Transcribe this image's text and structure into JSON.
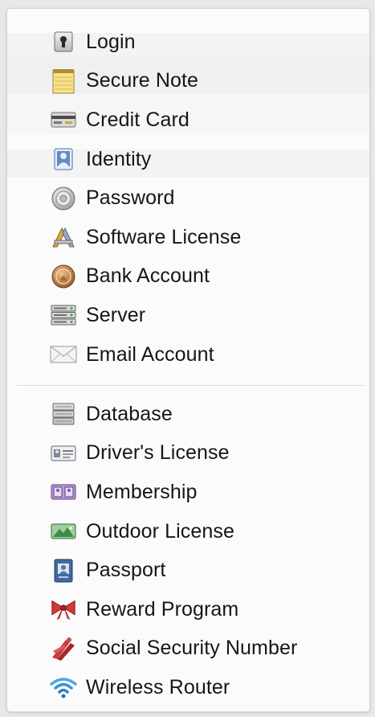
{
  "menu": {
    "group1": [
      {
        "label": "Login",
        "icon": "keyhole-icon"
      },
      {
        "label": "Secure Note",
        "icon": "notepad-icon"
      },
      {
        "label": "Credit Card",
        "icon": "credit-card-icon"
      },
      {
        "label": "Identity",
        "icon": "identity-icon"
      },
      {
        "label": "Password",
        "icon": "password-dial-icon"
      },
      {
        "label": "Software License",
        "icon": "app-store-icon"
      },
      {
        "label": "Bank Account",
        "icon": "bank-coin-icon"
      },
      {
        "label": "Server",
        "icon": "server-icon"
      },
      {
        "label": "Email Account",
        "icon": "envelope-icon"
      }
    ],
    "group2": [
      {
        "label": "Database",
        "icon": "database-icon"
      },
      {
        "label": "Driver's License",
        "icon": "drivers-license-icon"
      },
      {
        "label": "Membership",
        "icon": "membership-card-icon"
      },
      {
        "label": "Outdoor License",
        "icon": "outdoor-license-icon"
      },
      {
        "label": "Passport",
        "icon": "passport-icon"
      },
      {
        "label": "Reward Program",
        "icon": "bow-ribbon-icon"
      },
      {
        "label": "Social Security Number",
        "icon": "eagle-icon"
      },
      {
        "label": "Wireless Router",
        "icon": "wifi-icon"
      }
    ]
  },
  "colors": {
    "menu_background": "#fbfbfb",
    "text": "#161616",
    "divider": "#dcdcdc"
  }
}
